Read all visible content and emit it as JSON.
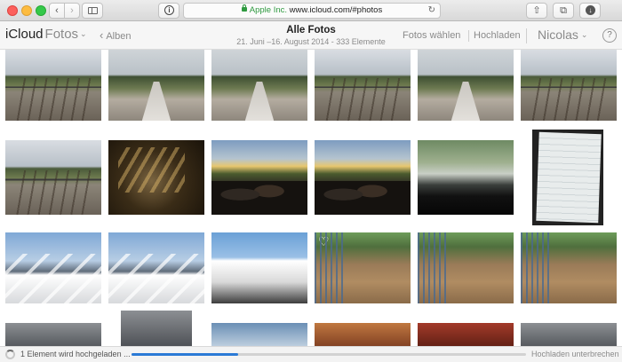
{
  "browser": {
    "url_company": "Apple Inc.",
    "url": "www.icloud.com/#photos",
    "back_glyph": "‹",
    "fwd_glyph": "›",
    "reader_glyph": "i",
    "reload_glyph": "↻",
    "share_glyph": "⇧",
    "tabs_glyph": "⧉",
    "download_glyph": "↓"
  },
  "header": {
    "brand": "iCloud",
    "app_name": "Fotos",
    "app_chevron": "⌄",
    "back_label": "Alben",
    "back_arrow": "‹",
    "title": "Alle Fotos",
    "subtitle": "21. Juni –16. August 2014 - 333 Elemente",
    "select_label": "Fotos wählen",
    "upload_label": "Hochladen",
    "user_name": "Nicolas",
    "user_chevron": "⌄",
    "help_glyph": "?"
  },
  "photos": [
    {
      "row": 0,
      "col": 0,
      "scene": "track"
    },
    {
      "row": 0,
      "col": 1,
      "scene": "path"
    },
    {
      "row": 0,
      "col": 2,
      "scene": "path"
    },
    {
      "row": 0,
      "col": 3,
      "scene": "track"
    },
    {
      "row": 0,
      "col": 4,
      "scene": "path"
    },
    {
      "row": 0,
      "col": 5,
      "scene": "track"
    },
    {
      "row": 1,
      "col": 0,
      "scene": "track"
    },
    {
      "row": 1,
      "col": 1,
      "scene": "dark"
    },
    {
      "row": 1,
      "col": 2,
      "scene": "crowd"
    },
    {
      "row": 1,
      "col": 3,
      "scene": "crowd"
    },
    {
      "row": 1,
      "col": 4,
      "scene": "car"
    },
    {
      "row": 1,
      "col": 5,
      "scene": "paper"
    },
    {
      "row": 2,
      "col": 0,
      "scene": "balcony"
    },
    {
      "row": 2,
      "col": 1,
      "scene": "balcony"
    },
    {
      "row": 2,
      "col": 2,
      "scene": "house"
    },
    {
      "row": 2,
      "col": 3,
      "scene": "terrace",
      "favorite": true
    },
    {
      "row": 2,
      "col": 4,
      "scene": "terrace"
    },
    {
      "row": 2,
      "col": 5,
      "scene": "terrace"
    },
    {
      "row": 3,
      "col": 0,
      "scene": "bottom"
    },
    {
      "row": 3,
      "col": 1,
      "scene": "bottom"
    },
    {
      "row": 3,
      "col": 2,
      "scene": "bottom2"
    },
    {
      "row": 3,
      "col": 3,
      "scene": "bottom3"
    },
    {
      "row": 3,
      "col": 4,
      "scene": "bottom4"
    },
    {
      "row": 3,
      "col": 5,
      "scene": "bottom"
    }
  ],
  "favorite_glyph": "♡",
  "upload": {
    "status_text": "1 Element wird hochgeladen ...",
    "progress": 0.27,
    "cancel_label": "Hochladen unterbrechen"
  }
}
